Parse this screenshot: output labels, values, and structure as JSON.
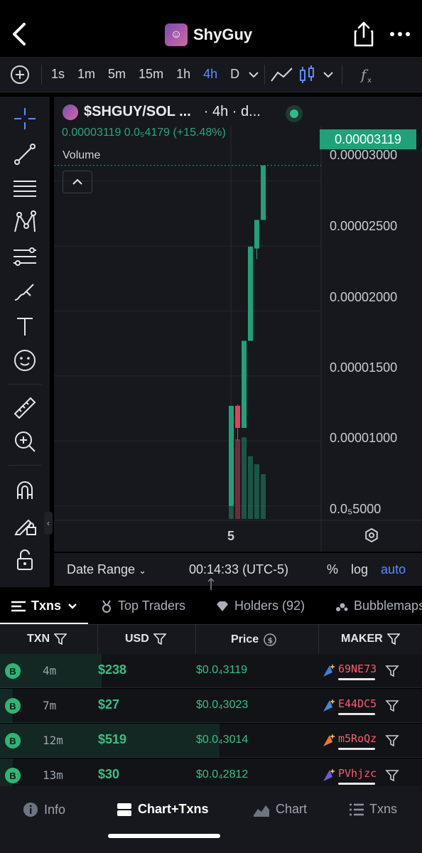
{
  "header": {
    "title": "ShyGuy"
  },
  "toolbar": {
    "timeframes": [
      "1s",
      "1m",
      "5m",
      "15m",
      "1h",
      "4h",
      "D"
    ],
    "active": "4h"
  },
  "chart": {
    "pair": "$SHGUY/SOL ...",
    "interval": "· 4h · d...",
    "ohlc": "0.00003119  0.0₅4179 (+15.48%)",
    "volume_label": "Volume",
    "current_price": "0.00003119",
    "y_ticks": [
      "0.00003000",
      "0.00002500",
      "0.00002000",
      "0.00001500",
      "0.00001000",
      "0.0₅5000"
    ],
    "x_tick": "5"
  },
  "chart_data": {
    "type": "candlestick",
    "y_axis_ticks": [
      3e-05,
      2.5e-05,
      2e-05,
      1.5e-05,
      1e-05,
      5e-06
    ],
    "ylim": [
      4e-06,
      3.32e-05
    ],
    "candles": [
      {
        "open": 5e-06,
        "close": 1.27e-05,
        "high": 1.27e-05,
        "low": 5e-06,
        "color": "up"
      },
      {
        "open": 1.27e-05,
        "close": 1.1e-05,
        "high": 1.28e-05,
        "low": 1e-05,
        "color": "down"
      },
      {
        "open": 1.1e-05,
        "close": 1.77e-05,
        "high": 1.77e-05,
        "low": 1.1e-05,
        "color": "up"
      },
      {
        "open": 1.77e-05,
        "close": 2.495e-05,
        "high": 2.495e-05,
        "low": 1.77e-05,
        "color": "up"
      },
      {
        "open": 2.48e-05,
        "close": 2.7e-05,
        "high": 2.7e-05,
        "low": 2.4e-05,
        "color": "up"
      },
      {
        "open": 2.7e-05,
        "close": 3.119e-05,
        "high": 3.119e-05,
        "low": 2.7e-05,
        "color": "up"
      }
    ],
    "volume": [
      0.24,
      0.8,
      0.82,
      0.63,
      0.55,
      0.45
    ]
  },
  "rangebar": {
    "date_range": "Date Range",
    "time": "00:14:33 (UTC-5)",
    "pct": "%",
    "log": "log",
    "auto": "auto"
  },
  "tabs": [
    {
      "label": "Txns"
    },
    {
      "label": "Top Traders"
    },
    {
      "label": "Holders (92)"
    },
    {
      "label": "Bubblemaps"
    }
  ],
  "table": {
    "headers": {
      "txn": "TXN",
      "usd": "USD",
      "price": "Price",
      "maker": "MAKER"
    },
    "rows": [
      {
        "type": "B",
        "age": "4m",
        "usd": "$238",
        "price": "$0.0₄3119",
        "maker": "69NE73",
        "bar": 0.24
      },
      {
        "type": "B",
        "age": "7m",
        "usd": "$27",
        "price": "$0.0₄3023",
        "maker": "E44DC5",
        "bar": 0.03
      },
      {
        "type": "B",
        "age": "12m",
        "usd": "$519",
        "price": "$0.0₄3014",
        "maker": "m5RoQz",
        "bar": 0.52
      },
      {
        "type": "B",
        "age": "13m",
        "usd": "$30",
        "price": "$0.0₄2812",
        "maker": "PVhjzc",
        "bar": 0.03
      }
    ]
  },
  "bottomnav": {
    "info": "Info",
    "chart_txns": "Chart+Txns",
    "chart": "Chart",
    "txns": "Txns"
  },
  "colors": {
    "up": "#1fa27a",
    "down": "#e0405a",
    "accent": "#5b8cff"
  }
}
